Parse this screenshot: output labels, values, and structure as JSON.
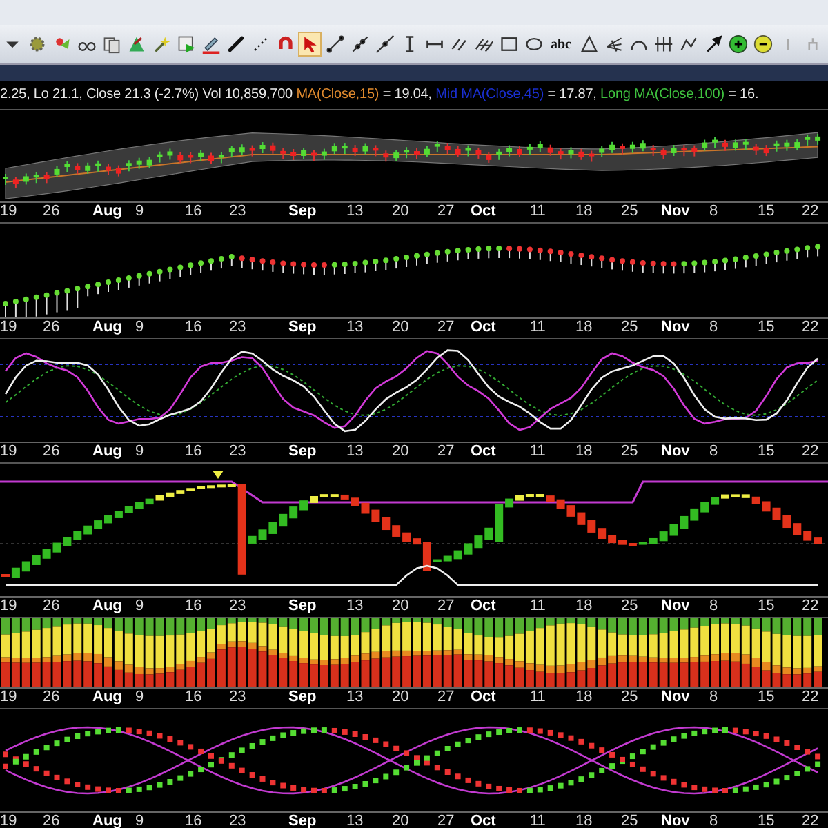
{
  "toolbar": {
    "tools": [
      {
        "kind": "dropdown",
        "selected": false
      },
      {
        "kind": "gear",
        "selected": false
      },
      {
        "kind": "hearts",
        "selected": false
      },
      {
        "kind": "glasses",
        "selected": false
      },
      {
        "kind": "cards",
        "selected": false
      },
      {
        "kind": "wizard",
        "selected": false
      },
      {
        "kind": "wand",
        "selected": false
      },
      {
        "kind": "export",
        "selected": false
      },
      {
        "kind": "pencil",
        "selected": false
      },
      {
        "kind": "brush",
        "selected": false
      },
      {
        "kind": "dots",
        "selected": false
      },
      {
        "kind": "magnet",
        "selected": false
      },
      {
        "kind": "pointer",
        "selected": true
      },
      {
        "kind": "segment",
        "selected": false
      },
      {
        "kind": "ray",
        "selected": false
      },
      {
        "kind": "extended",
        "selected": false
      },
      {
        "kind": "vertical",
        "selected": false
      },
      {
        "kind": "horizontal",
        "selected": false
      },
      {
        "kind": "parallel",
        "selected": false
      },
      {
        "kind": "channel",
        "selected": false
      },
      {
        "kind": "rectangle",
        "selected": false
      },
      {
        "kind": "ellipse",
        "selected": false
      },
      {
        "kind": "text",
        "selected": false,
        "label": "abc"
      },
      {
        "kind": "triangle",
        "selected": false
      },
      {
        "kind": "fan",
        "selected": false
      },
      {
        "kind": "arc",
        "selected": false
      },
      {
        "kind": "cycles",
        "selected": false
      },
      {
        "kind": "zigzag",
        "selected": false
      },
      {
        "kind": "arrow",
        "selected": false
      },
      {
        "kind": "zoom-in",
        "selected": false
      },
      {
        "kind": "zoom-out",
        "selected": false
      },
      {
        "kind": "faint-a",
        "selected": false
      },
      {
        "kind": "faint-b",
        "selected": false
      }
    ]
  },
  "legend": [
    {
      "text": "2.25, Lo 21.1, Close 21.3 (-2.7%) Vol 10,859,700 ",
      "color": "#e8e8e8"
    },
    {
      "text": "MA(Close,15)",
      "color": "#e08a2e"
    },
    {
      "text": " = 19.04, ",
      "color": "#e8e8e8"
    },
    {
      "text": "Mid MA(Close,45)",
      "color": "#1a2fd0"
    },
    {
      "text": " = 17.87, ",
      "color": "#e8e8e8"
    },
    {
      "text": "Long MA(Close,100)",
      "color": "#3fc23f"
    },
    {
      "text": " = 16.",
      "color": "#e8e8e8"
    }
  ],
  "panels": [
    {
      "kind": "candles",
      "axis": [
        {
          "t": "19",
          "month": false
        },
        {
          "t": "26",
          "month": false
        },
        {
          "t": "Aug",
          "month": true
        },
        {
          "t": "9",
          "month": false
        },
        {
          "t": "16",
          "month": false
        },
        {
          "t": "23",
          "month": false
        },
        {
          "t": "Sep",
          "month": true
        },
        {
          "t": "13",
          "month": false
        },
        {
          "t": "20",
          "month": false
        },
        {
          "t": "27",
          "month": false
        },
        {
          "t": "Oct",
          "month": true
        },
        {
          "t": "11",
          "month": false
        },
        {
          "t": "18",
          "month": false
        },
        {
          "t": "25",
          "month": false
        },
        {
          "t": "Nov",
          "month": true
        },
        {
          "t": "8",
          "month": false
        },
        {
          "t": "15",
          "month": false
        },
        {
          "t": "22",
          "month": false
        }
      ]
    },
    {
      "kind": "dots",
      "axis": [
        {
          "t": "19",
          "month": false
        },
        {
          "t": "26",
          "month": false
        },
        {
          "t": "Aug",
          "month": true
        },
        {
          "t": "9",
          "month": false
        },
        {
          "t": "16",
          "month": false
        },
        {
          "t": "23",
          "month": false
        },
        {
          "t": "Sep",
          "month": true
        },
        {
          "t": "13",
          "month": false
        },
        {
          "t": "20",
          "month": false
        },
        {
          "t": "27",
          "month": false
        },
        {
          "t": "Oct",
          "month": true
        },
        {
          "t": "11",
          "month": false
        },
        {
          "t": "18",
          "month": false
        },
        {
          "t": "25",
          "month": false
        },
        {
          "t": "Nov",
          "month": true
        },
        {
          "t": "8",
          "month": false
        },
        {
          "t": "15",
          "month": false
        },
        {
          "t": "22",
          "month": false
        }
      ]
    },
    {
      "kind": "oscillator",
      "axis": [
        {
          "t": "19",
          "month": false
        },
        {
          "t": "26",
          "month": false
        },
        {
          "t": "Aug",
          "month": true
        },
        {
          "t": "9",
          "month": false
        },
        {
          "t": "16",
          "month": false
        },
        {
          "t": "23",
          "month": false
        },
        {
          "t": "Sep",
          "month": true
        },
        {
          "t": "13",
          "month": false
        },
        {
          "t": "20",
          "month": false
        },
        {
          "t": "27",
          "month": false
        },
        {
          "t": "Oct",
          "month": true
        },
        {
          "t": "11",
          "month": false
        },
        {
          "t": "18",
          "month": false
        },
        {
          "t": "25",
          "month": false
        },
        {
          "t": "Nov",
          "month": true
        },
        {
          "t": "8",
          "month": false
        },
        {
          "t": "15",
          "month": false
        },
        {
          "t": "22",
          "month": false
        }
      ]
    },
    {
      "kind": "boxes",
      "axis": [
        {
          "t": "19",
          "month": false
        },
        {
          "t": "26",
          "month": false
        },
        {
          "t": "Aug",
          "month": true
        },
        {
          "t": "9",
          "month": false
        },
        {
          "t": "16",
          "month": false
        },
        {
          "t": "23",
          "month": false
        },
        {
          "t": "Sep",
          "month": true
        },
        {
          "t": "13",
          "month": false
        },
        {
          "t": "20",
          "month": false
        },
        {
          "t": "27",
          "month": false
        },
        {
          "t": "Oct",
          "month": true
        },
        {
          "t": "11",
          "month": false
        },
        {
          "t": "18",
          "month": false
        },
        {
          "t": "25",
          "month": false
        },
        {
          "t": "Nov",
          "month": true
        },
        {
          "t": "8",
          "month": false
        },
        {
          "t": "15",
          "month": false
        },
        {
          "t": "22",
          "month": false
        }
      ]
    },
    {
      "kind": "heat",
      "axis": [
        {
          "t": "19",
          "month": false
        },
        {
          "t": "26",
          "month": false
        },
        {
          "t": "Aug",
          "month": true
        },
        {
          "t": "9",
          "month": false
        },
        {
          "t": "16",
          "month": false
        },
        {
          "t": "23",
          "month": false
        },
        {
          "t": "Sep",
          "month": true
        },
        {
          "t": "13",
          "month": false
        },
        {
          "t": "20",
          "month": false
        },
        {
          "t": "27",
          "month": false
        },
        {
          "t": "Oct",
          "month": true
        },
        {
          "t": "11",
          "month": false
        },
        {
          "t": "18",
          "month": false
        },
        {
          "t": "25",
          "month": false
        },
        {
          "t": "Nov",
          "month": true
        },
        {
          "t": "8",
          "month": false
        },
        {
          "t": "15",
          "month": false
        },
        {
          "t": "22",
          "month": false
        }
      ]
    },
    {
      "kind": "cross",
      "axis": [
        {
          "t": "19",
          "month": false
        },
        {
          "t": "26",
          "month": false
        },
        {
          "t": "Aug",
          "month": true
        },
        {
          "t": "9",
          "month": false
        },
        {
          "t": "16",
          "month": false
        },
        {
          "t": "23",
          "month": false
        },
        {
          "t": "Sep",
          "month": true
        },
        {
          "t": "13",
          "month": false
        },
        {
          "t": "20",
          "month": false
        },
        {
          "t": "27",
          "month": false
        },
        {
          "t": "Oct",
          "month": true
        },
        {
          "t": "11",
          "month": false
        },
        {
          "t": "18",
          "month": false
        },
        {
          "t": "25",
          "month": false
        },
        {
          "t": "Nov",
          "month": true
        },
        {
          "t": "8",
          "month": false
        },
        {
          "t": "15",
          "month": false
        },
        {
          "t": "22",
          "month": false
        }
      ]
    }
  ]
}
